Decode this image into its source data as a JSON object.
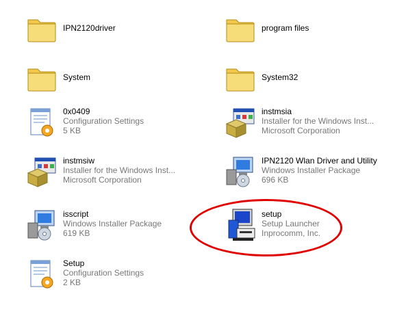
{
  "items": [
    {
      "name": "IPN2120driver",
      "line2": "",
      "line3": "",
      "icon": "folder-icon"
    },
    {
      "name": "program files",
      "line2": "",
      "line3": "",
      "icon": "folder-icon"
    },
    {
      "name": "System",
      "line2": "",
      "line3": "",
      "icon": "folder-icon"
    },
    {
      "name": "System32",
      "line2": "",
      "line3": "",
      "icon": "folder-icon"
    },
    {
      "name": "0x0409",
      "line2": "Configuration Settings",
      "line3": "5 KB",
      "icon": "config-settings-icon"
    },
    {
      "name": "instmsia",
      "line2": "Installer for the Windows Inst...",
      "line3": "Microsoft Corporation",
      "icon": "installer-box-icon"
    },
    {
      "name": "instmsiw",
      "line2": "Installer for the Windows Inst...",
      "line3": "Microsoft Corporation",
      "icon": "installer-box-icon"
    },
    {
      "name": "IPN2120 Wlan Driver and Utility",
      "line2": "Windows Installer Package",
      "line3": "696 KB",
      "icon": "installer-package-icon"
    },
    {
      "name": "isscript",
      "line2": "Windows Installer Package",
      "line3": "619 KB",
      "icon": "installer-package-icon"
    },
    {
      "name": "setup",
      "line2": "Setup Launcher",
      "line3": "Inprocomm, Inc.",
      "icon": "setup-launcher-icon"
    },
    {
      "name": "Setup",
      "line2": "Configuration Settings",
      "line3": "2 KB",
      "icon": "config-settings-icon"
    }
  ],
  "highlight_color": "#e00000"
}
